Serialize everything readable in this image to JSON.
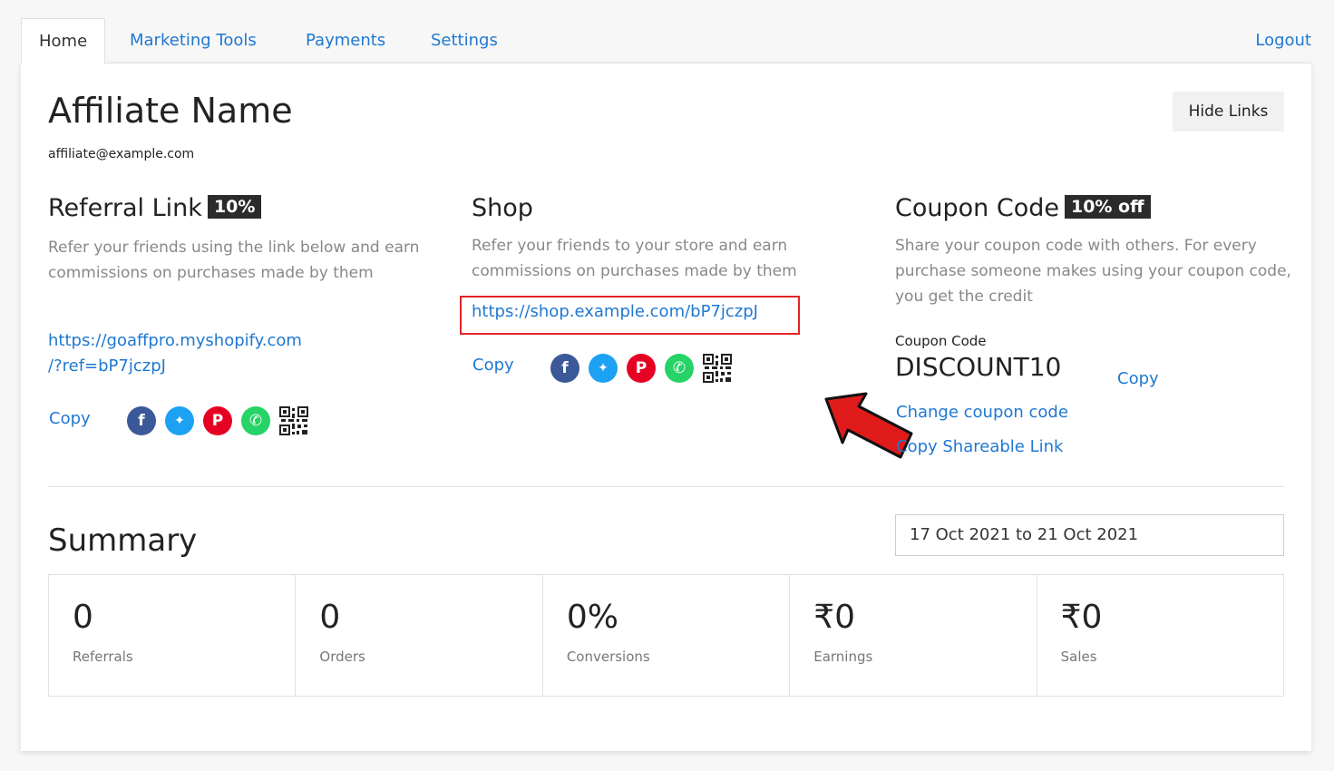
{
  "nav": {
    "tabs": [
      {
        "label": "Home"
      },
      {
        "label": "Marketing Tools"
      },
      {
        "label": "Payments"
      },
      {
        "label": "Settings"
      }
    ],
    "logout": "Logout"
  },
  "profile": {
    "name": "Affiliate Name",
    "email": "affiliate@example.com",
    "hide_links_button": "Hide Links"
  },
  "referral": {
    "title": "Referral Link",
    "badge": "10%",
    "description": "Refer your friends using the link below and earn commissions on purchases made by them",
    "link_line1": "https://goaffpro.myshopify.com",
    "link_line2": "/?ref=bP7jczpJ",
    "copy": "Copy"
  },
  "shop": {
    "title": "Shop",
    "description": "Refer your friends to your store and earn commissions on purchases made by them",
    "link": "https://shop.example.com/bP7jczpJ",
    "copy": "Copy"
  },
  "coupon": {
    "title": "Coupon Code",
    "badge": "10% off",
    "description": "Share your coupon code with others. For every purchase someone makes using your coupon code, you get the credit",
    "label": "Coupon Code",
    "code": "DISCOUNT10",
    "copy": "Copy",
    "change": "Change coupon code",
    "copy_shareable": "Copy Shareable Link"
  },
  "social_icons": [
    "facebook-icon",
    "twitter-icon",
    "pinterest-icon",
    "whatsapp-icon",
    "qr-code-icon"
  ],
  "summary": {
    "title": "Summary",
    "date_range": "17 Oct 2021 to 21 Oct 2021",
    "stats": [
      {
        "value": "0",
        "label": "Referrals"
      },
      {
        "value": "0",
        "label": "Orders"
      },
      {
        "value": "0%",
        "label": "Conversions"
      },
      {
        "value": "₹0",
        "label": "Earnings"
      },
      {
        "value": "₹0",
        "label": "Sales"
      }
    ]
  },
  "colors": {
    "link": "#1f78d1",
    "highlight_box": "#e12525",
    "badge_bg": "#2b2b2b"
  }
}
